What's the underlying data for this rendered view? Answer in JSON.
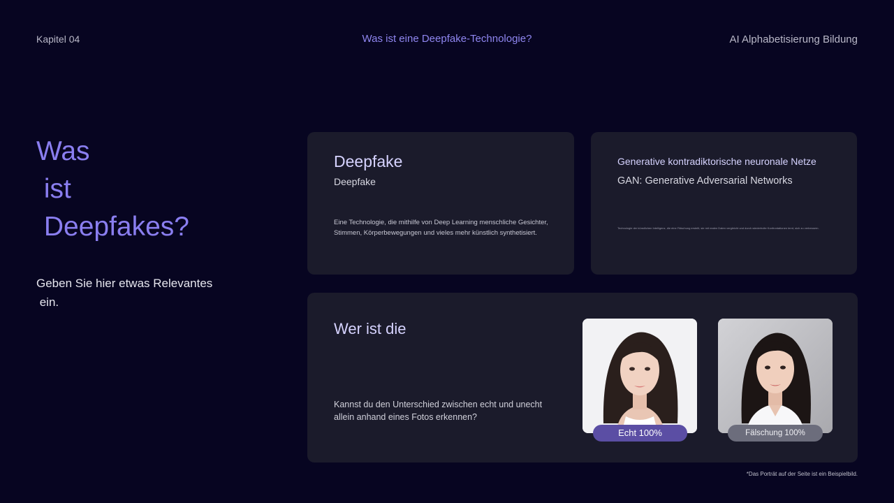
{
  "header": {
    "chapter": "Kapitel 04",
    "topic": "Was ist eine Deepfake-Technologie?",
    "brand": "AI Alphabetisierung Bildung"
  },
  "hero": {
    "title_lines": [
      "Was",
      " ist",
      " Deepfakes?"
    ],
    "subtitle": "Geben Sie hier etwas Relevantes\n ein."
  },
  "card_deepfake": {
    "title": "Deepfake",
    "subtitle": "Deepfake",
    "text": "Eine Technologie, die mithilfe von Deep Learning menschliche Gesichter, Stimmen, Körperbewegungen und vieles mehr künstlich synthetisiert."
  },
  "card_gan": {
    "title": "Generative kontradiktorische neuronale Netze",
    "subtitle": "GAN: Generative Adversarial Networks",
    "text": "Technologie der künstlichen Intelligenz, die eine Fälschung erstellt, sie mit realen Daten vergleicht und durch wiederholte Konfrontationen lernt, sich zu verbessern."
  },
  "card_quiz": {
    "title": "Wer ist die",
    "text": "Kannst du den Unterschied zwischen echt und unecht allein anhand eines Fotos erkennen?",
    "real_badge": "Echt 100%",
    "fake_badge": "Fälschung 100%"
  },
  "footnote": "*Das Porträt auf der Seite ist ein Beispielbild.",
  "colors": {
    "background": "#070521",
    "accent": "#8a7ef0",
    "card": "#1b1b2b",
    "real_badge": "#5b4ea4",
    "fake_badge": "#6c6d7c"
  }
}
